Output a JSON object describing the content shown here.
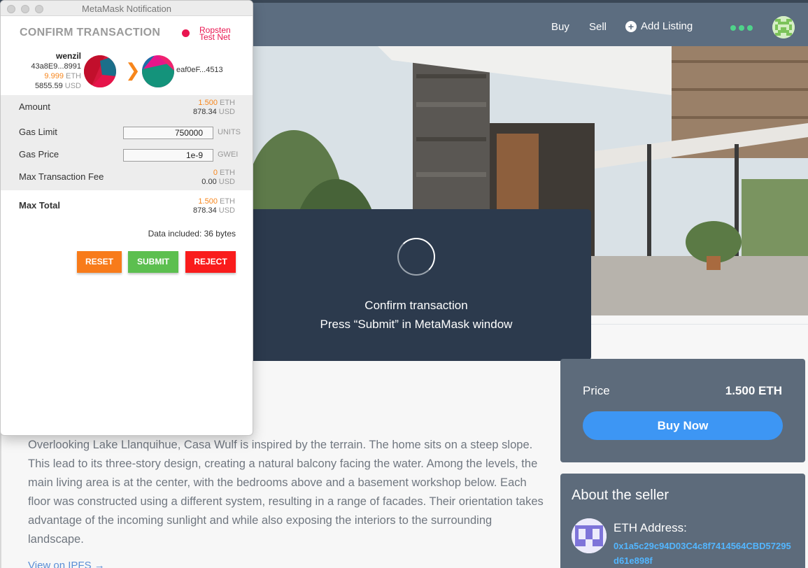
{
  "app": {
    "nav": {
      "buy": "Buy",
      "sell": "Sell",
      "add_listing": "Add Listing"
    },
    "overlay": {
      "line1": "Confirm transaction",
      "line2": "Press “Submit” in MetaMask window"
    },
    "description": "Overlooking Lake Llanquihue, Casa Wulf is inspired by the terrain. The home sits on a steep slope. This lead to its three-story design, creating a natural balcony facing the water. Among the levels, the main living area is at the center, with the bedrooms above and a basement workshop below. Each floor was constructed using a different system, resulting in a range of facades. Their orientation takes advantage of the incoming sunlight and while also exposing the interiors to the surrounding landscape.",
    "description_link": "View on IPFS →",
    "price_card": {
      "label": "Price",
      "value": "1.500 ETH",
      "buy_button": "Buy Now"
    },
    "seller": {
      "title": "About the seller",
      "eth_label": "ETH Address:",
      "eth_address": "0x1a5c29c94D03C4c8f7414564CBD57295d61e898f"
    }
  },
  "metamask": {
    "window_title": "MetaMask Notification",
    "heading": "CONFIRM TRANSACTION",
    "network": "Ropsten Test Net",
    "from": {
      "name": "wenzil",
      "address": "43a8E9...8991",
      "eth_balance": "9.999",
      "eth_unit": "ETH",
      "usd_balance": "5855.59",
      "usd_unit": "USD"
    },
    "to": {
      "address": "eaf0eF...4513"
    },
    "amount": {
      "label": "Amount",
      "eth": "1.500",
      "eth_unit": "ETH",
      "usd": "878.34",
      "usd_unit": "USD"
    },
    "gas_limit": {
      "label": "Gas Limit",
      "value": "750000",
      "unit": "UNITS"
    },
    "gas_price": {
      "label": "Gas Price",
      "value": "1e-9",
      "unit": "GWEI"
    },
    "max_fee": {
      "label": "Max Transaction Fee",
      "eth": "0",
      "eth_unit": "ETH",
      "usd": "0.00",
      "usd_unit": "USD"
    },
    "max_total": {
      "label": "Max Total",
      "eth": "1.500",
      "eth_unit": "ETH",
      "usd": "878.34",
      "usd_unit": "USD"
    },
    "data_included": "Data included: 36 bytes",
    "buttons": {
      "reset": "RESET",
      "submit": "SUBMIT",
      "reject": "REJECT"
    }
  },
  "colors": {
    "nav_bg": "#5c6d80",
    "overlay_bg": "#2c3a4d",
    "card_bg": "#5d6b7b",
    "buy_now": "#3d96f4",
    "network_red": "#e91550",
    "eth_orange": "#f7861c",
    "reset_orange": "#f87b1a",
    "submit_green": "#5cbf4f",
    "reject_red": "#f91c1c"
  },
  "icons": {
    "add_listing": "plus-circle-icon",
    "menu": "more-dots-icon",
    "user": "identicon-avatar",
    "arrow": "chevron-right-icon",
    "spinner": "loading-spinner-icon"
  }
}
